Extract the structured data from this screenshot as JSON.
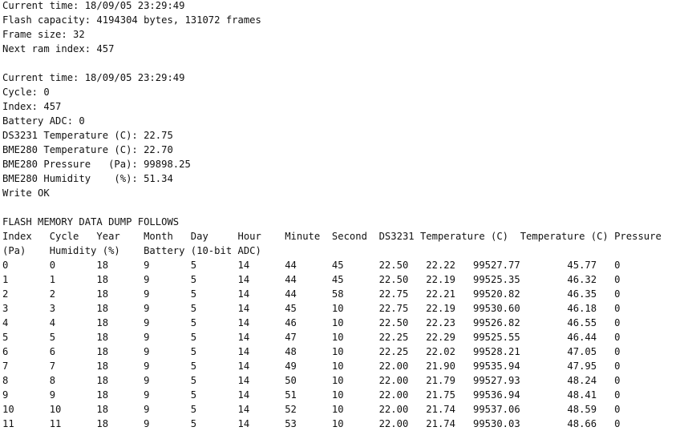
{
  "terminal": {
    "lines": [
      "Current time: 18/09/05 23:29:49",
      "Flash capacity: 4194304 bytes, 131072 frames",
      "Frame size: 32",
      "Next ram index: 457",
      "",
      "Current time: 18/09/05 23:29:49",
      "Cycle: 0",
      "Index: 457",
      "Battery ADC: 0",
      "DS3231 Temperature (C): 22.75",
      "BME280 Temperature (C): 22.70",
      "BME280 Pressure   (Pa): 99898.25",
      "BME280 Humidity    (%): 51.34",
      "Write OK",
      "",
      "FLASH MEMORY DATA DUMP FOLLOWS",
      "Index   Cycle   Year    Month   Day     Hour    Minute  Second  DS3231 Temperature (C)  Temperature (C) Pressure",
      "(Pa)    Humidity (%)    Battery (10-bit ADC)",
      "0       0       18      9       5       14      44      45      22.50   22.22   99527.77        45.77   0",
      "1       1       18      9       5       14      44      45      22.50   22.19   99525.35        46.32   0",
      "2       2       18      9       5       14      44      58      22.75   22.21   99520.82        46.35   0",
      "3       3       18      9       5       14      45      10      22.75   22.19   99530.60        46.18   0",
      "4       4       18      9       5       14      46      10      22.50   22.23   99526.82        46.55   0",
      "5       5       18      9       5       14      47      10      22.25   22.29   99525.55        46.44   0",
      "6       6       18      9       5       14      48      10      22.25   22.02   99528.21        47.05   0",
      "7       7       18      9       5       14      49      10      22.00   21.90   99535.94        47.95   0",
      "8       8       18      9       5       14      50      10      22.00   21.79   99527.93        48.24   0",
      "9       9       18      9       5       14      51      10      22.00   21.75   99536.94        48.41   0",
      "10      10      18      9       5       14      52      10      22.00   21.74   99537.06        48.59   0",
      "11      11      18      9       5       14      53      10      22.00   21.74   99530.03        48.66   0"
    ]
  }
}
